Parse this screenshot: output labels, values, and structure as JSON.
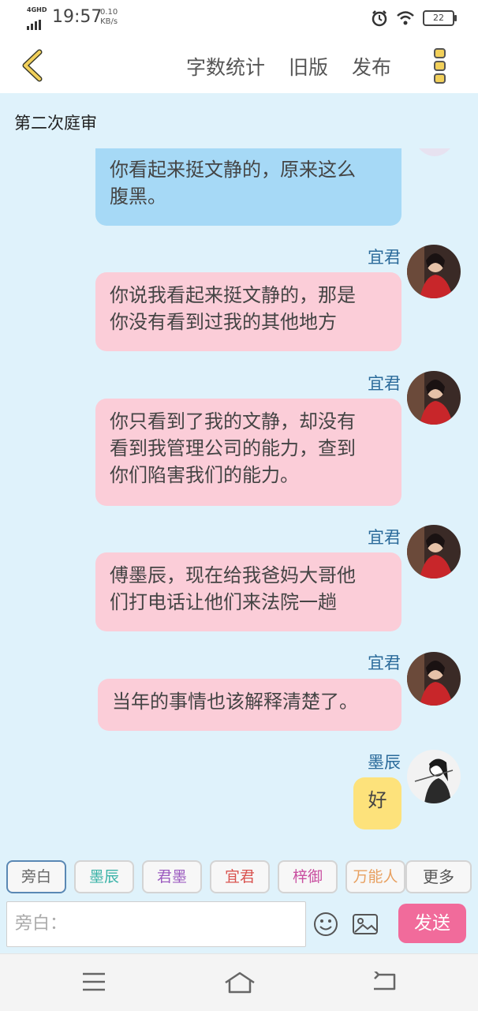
{
  "status_bar": {
    "network": "4GHD",
    "time": "19:57",
    "speed_value": "0.10",
    "speed_unit": "KB/s",
    "battery": "22",
    "icons": [
      "signal-icon",
      "alarm-icon",
      "wifi-icon",
      "battery-icon"
    ]
  },
  "header": {
    "back_icon": "chevron-left-icon",
    "actions": [
      "字数统计",
      "旧版",
      "发布"
    ],
    "menu_icon": "vertical-dots-icon",
    "accent_color": "#f2d05a"
  },
  "chapter_title": "第二次庭审",
  "messages": [
    {
      "sender": "",
      "text_lines": [
        "你看起来挺文静的，原来这么",
        "腹黑。"
      ],
      "color": "#a6d9f6"
    },
    {
      "sender": "宜君",
      "text_lines": [
        "你说我看起来挺文静的，那是",
        "你没有看到过我的其他地方"
      ],
      "color": "#fbcdd8"
    },
    {
      "sender": "宜君",
      "text_lines": [
        "你只看到了我的文静，却没有",
        "看到我管理公司的能力，查到",
        "你们陷害我们的能力。"
      ],
      "color": "#fbcdd8"
    },
    {
      "sender": "宜君",
      "text_lines": [
        "傅墨辰，现在给我爸妈大哥他",
        "们打电话让他们来法院一趟"
      ],
      "color": "#fbcdd8"
    },
    {
      "sender": "宜君",
      "text_lines": [
        "当年的事情也该解释清楚了。"
      ],
      "color": "#fbcdd8"
    },
    {
      "sender": "墨辰",
      "text_lines": [
        "好"
      ],
      "color": "#fde27b"
    }
  ],
  "roles": [
    {
      "label": "旁白",
      "color": "#666666"
    },
    {
      "label": "墨辰",
      "color": "#3bb3a8"
    },
    {
      "label": "君墨",
      "color": "#9c5cc0"
    },
    {
      "label": "宜君",
      "color": "#d9534f"
    },
    {
      "label": "梓御",
      "color": "#c94fa0"
    },
    {
      "label": "万能人",
      "color": "#e8a060"
    }
  ],
  "more_label": "更多",
  "input_placeholder": "旁白：",
  "send_label": "发送",
  "input_icons": [
    "emoji-icon",
    "image-icon"
  ],
  "nav_icons": [
    "menu-lines-icon",
    "home-icon",
    "back-arrow-icon"
  ]
}
